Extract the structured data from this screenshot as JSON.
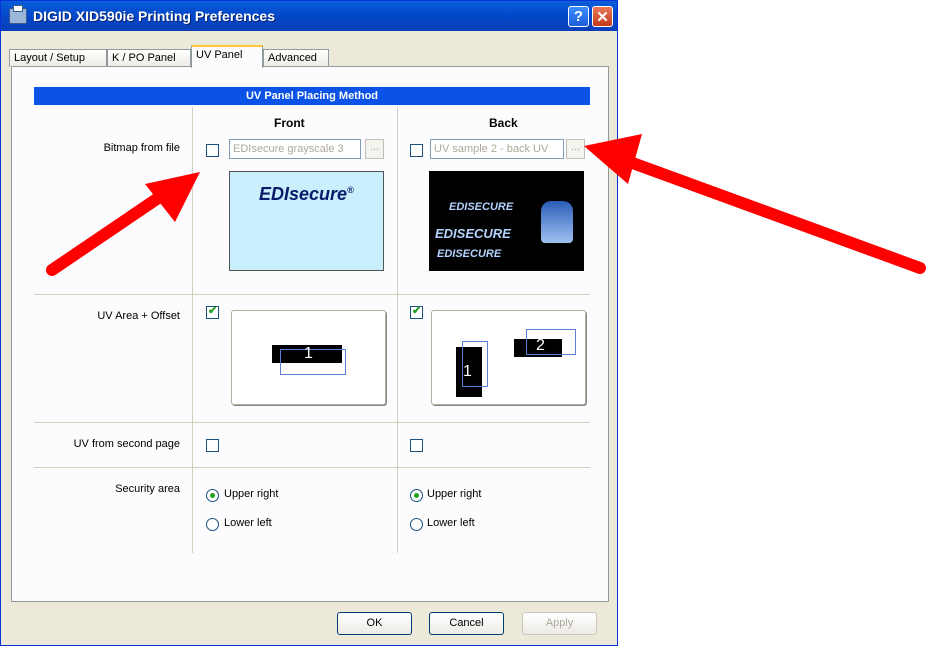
{
  "window": {
    "title": "DIGID XID590ie Printing Preferences",
    "help": "?",
    "close": "X"
  },
  "tabs": [
    "Layout / Setup",
    "K / PO Panel",
    "UV Panel",
    "Advanced"
  ],
  "panel": {
    "header": "UV Panel Placing Method",
    "columns": {
      "front": "Front",
      "back": "Back"
    },
    "rows": {
      "bitmap": "Bitmap from file",
      "area": "UV Area + Offset",
      "second": "UV from second page",
      "security": "Security area"
    },
    "front": {
      "bitmap_file": "EDIsecure grayscale 3",
      "browse": "...",
      "logo": "EDIsecure",
      "logo_reg": "®",
      "area_marker": "1",
      "radio_upper": "Upper right",
      "radio_lower": "Lower left"
    },
    "back": {
      "bitmap_file": "UV sample 2 - back UV",
      "browse": "...",
      "logo1": "EDISECURE",
      "logo2": "EDISECURE",
      "logo3": "EDISECURE",
      "marker1": "1",
      "marker2": "2",
      "radio_upper": "Upper right",
      "radio_lower": "Lower left"
    }
  },
  "buttons": {
    "ok": "OK",
    "cancel": "Cancel",
    "apply": "Apply"
  },
  "colors": {
    "title_blue": "#0348cc",
    "header_blue": "#0b53e7",
    "arrow_red": "#ff0000"
  }
}
